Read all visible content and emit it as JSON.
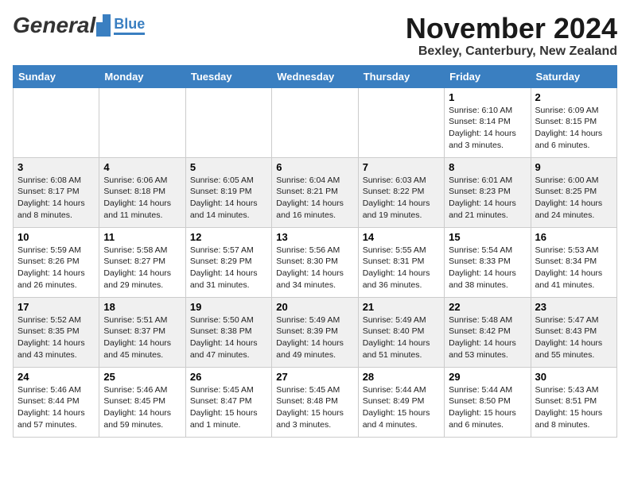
{
  "header": {
    "logo_general": "General",
    "logo_blue": "Blue",
    "month_title": "November 2024",
    "location": "Bexley, Canterbury, New Zealand"
  },
  "weekdays": [
    "Sunday",
    "Monday",
    "Tuesday",
    "Wednesday",
    "Thursday",
    "Friday",
    "Saturday"
  ],
  "weeks": [
    [
      {
        "day": "",
        "info": ""
      },
      {
        "day": "",
        "info": ""
      },
      {
        "day": "",
        "info": ""
      },
      {
        "day": "",
        "info": ""
      },
      {
        "day": "",
        "info": ""
      },
      {
        "day": "1",
        "info": "Sunrise: 6:10 AM\nSunset: 8:14 PM\nDaylight: 14 hours\nand 3 minutes."
      },
      {
        "day": "2",
        "info": "Sunrise: 6:09 AM\nSunset: 8:15 PM\nDaylight: 14 hours\nand 6 minutes."
      }
    ],
    [
      {
        "day": "3",
        "info": "Sunrise: 6:08 AM\nSunset: 8:17 PM\nDaylight: 14 hours\nand 8 minutes."
      },
      {
        "day": "4",
        "info": "Sunrise: 6:06 AM\nSunset: 8:18 PM\nDaylight: 14 hours\nand 11 minutes."
      },
      {
        "day": "5",
        "info": "Sunrise: 6:05 AM\nSunset: 8:19 PM\nDaylight: 14 hours\nand 14 minutes."
      },
      {
        "day": "6",
        "info": "Sunrise: 6:04 AM\nSunset: 8:21 PM\nDaylight: 14 hours\nand 16 minutes."
      },
      {
        "day": "7",
        "info": "Sunrise: 6:03 AM\nSunset: 8:22 PM\nDaylight: 14 hours\nand 19 minutes."
      },
      {
        "day": "8",
        "info": "Sunrise: 6:01 AM\nSunset: 8:23 PM\nDaylight: 14 hours\nand 21 minutes."
      },
      {
        "day": "9",
        "info": "Sunrise: 6:00 AM\nSunset: 8:25 PM\nDaylight: 14 hours\nand 24 minutes."
      }
    ],
    [
      {
        "day": "10",
        "info": "Sunrise: 5:59 AM\nSunset: 8:26 PM\nDaylight: 14 hours\nand 26 minutes."
      },
      {
        "day": "11",
        "info": "Sunrise: 5:58 AM\nSunset: 8:27 PM\nDaylight: 14 hours\nand 29 minutes."
      },
      {
        "day": "12",
        "info": "Sunrise: 5:57 AM\nSunset: 8:29 PM\nDaylight: 14 hours\nand 31 minutes."
      },
      {
        "day": "13",
        "info": "Sunrise: 5:56 AM\nSunset: 8:30 PM\nDaylight: 14 hours\nand 34 minutes."
      },
      {
        "day": "14",
        "info": "Sunrise: 5:55 AM\nSunset: 8:31 PM\nDaylight: 14 hours\nand 36 minutes."
      },
      {
        "day": "15",
        "info": "Sunrise: 5:54 AM\nSunset: 8:33 PM\nDaylight: 14 hours\nand 38 minutes."
      },
      {
        "day": "16",
        "info": "Sunrise: 5:53 AM\nSunset: 8:34 PM\nDaylight: 14 hours\nand 41 minutes."
      }
    ],
    [
      {
        "day": "17",
        "info": "Sunrise: 5:52 AM\nSunset: 8:35 PM\nDaylight: 14 hours\nand 43 minutes."
      },
      {
        "day": "18",
        "info": "Sunrise: 5:51 AM\nSunset: 8:37 PM\nDaylight: 14 hours\nand 45 minutes."
      },
      {
        "day": "19",
        "info": "Sunrise: 5:50 AM\nSunset: 8:38 PM\nDaylight: 14 hours\nand 47 minutes."
      },
      {
        "day": "20",
        "info": "Sunrise: 5:49 AM\nSunset: 8:39 PM\nDaylight: 14 hours\nand 49 minutes."
      },
      {
        "day": "21",
        "info": "Sunrise: 5:49 AM\nSunset: 8:40 PM\nDaylight: 14 hours\nand 51 minutes."
      },
      {
        "day": "22",
        "info": "Sunrise: 5:48 AM\nSunset: 8:42 PM\nDaylight: 14 hours\nand 53 minutes."
      },
      {
        "day": "23",
        "info": "Sunrise: 5:47 AM\nSunset: 8:43 PM\nDaylight: 14 hours\nand 55 minutes."
      }
    ],
    [
      {
        "day": "24",
        "info": "Sunrise: 5:46 AM\nSunset: 8:44 PM\nDaylight: 14 hours\nand 57 minutes."
      },
      {
        "day": "25",
        "info": "Sunrise: 5:46 AM\nSunset: 8:45 PM\nDaylight: 14 hours\nand 59 minutes."
      },
      {
        "day": "26",
        "info": "Sunrise: 5:45 AM\nSunset: 8:47 PM\nDaylight: 15 hours\nand 1 minute."
      },
      {
        "day": "27",
        "info": "Sunrise: 5:45 AM\nSunset: 8:48 PM\nDaylight: 15 hours\nand 3 minutes."
      },
      {
        "day": "28",
        "info": "Sunrise: 5:44 AM\nSunset: 8:49 PM\nDaylight: 15 hours\nand 4 minutes."
      },
      {
        "day": "29",
        "info": "Sunrise: 5:44 AM\nSunset: 8:50 PM\nDaylight: 15 hours\nand 6 minutes."
      },
      {
        "day": "30",
        "info": "Sunrise: 5:43 AM\nSunset: 8:51 PM\nDaylight: 15 hours\nand 8 minutes."
      }
    ]
  ]
}
